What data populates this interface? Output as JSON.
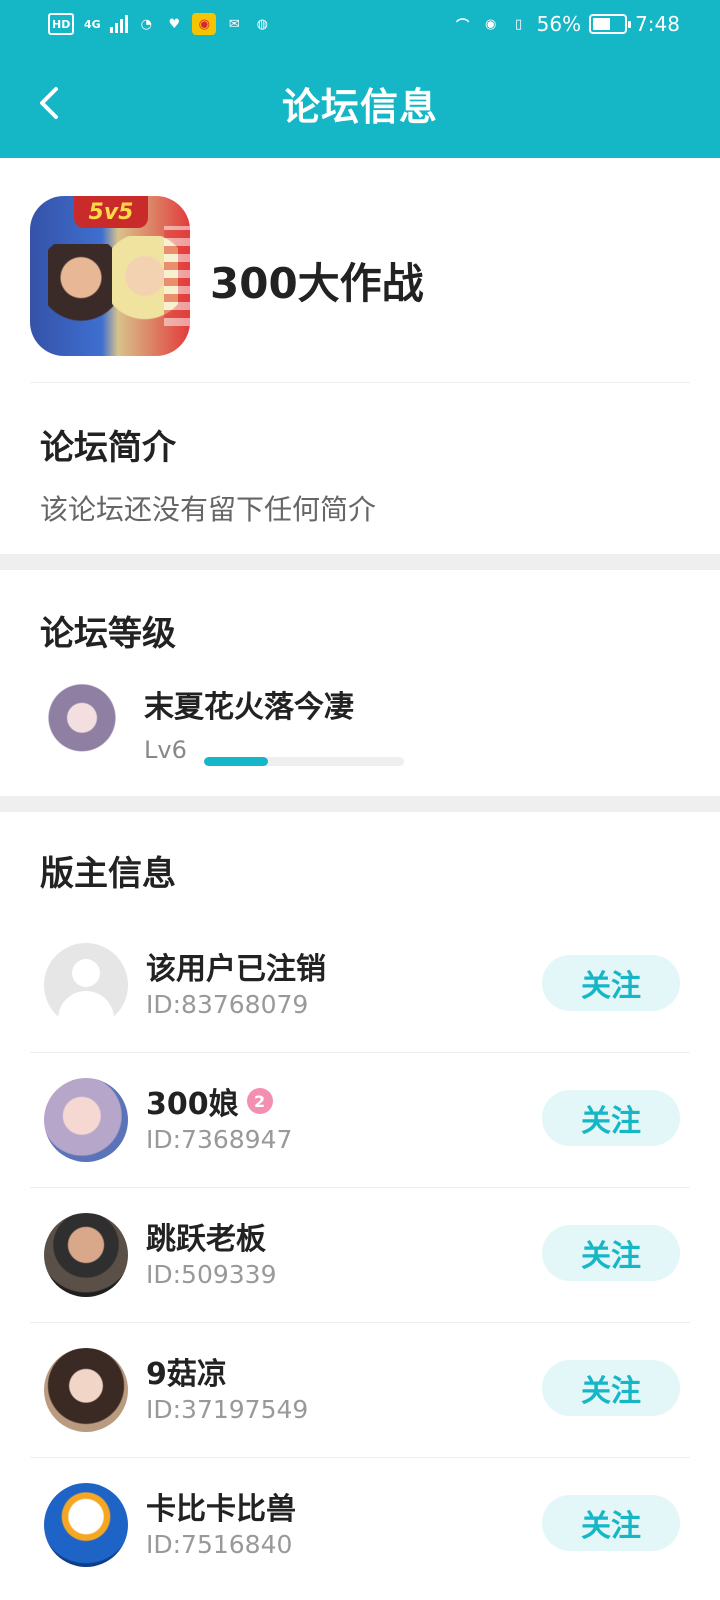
{
  "status_bar": {
    "hd": "HD",
    "network": "4G",
    "battery_percent": "56%",
    "time": "7:48",
    "battery_level": 0.56
  },
  "navbar": {
    "title": "论坛信息",
    "back_icon": "chevron-left-icon"
  },
  "forum": {
    "name": "300大作战",
    "logo_badge": "5v5"
  },
  "intro": {
    "title": "论坛简介",
    "text": "该论坛还没有留下任何简介"
  },
  "level": {
    "title": "论坛等级",
    "user_name": "末夏花火落今凄",
    "level_label": "Lv6",
    "progress": 0.32
  },
  "moderators": {
    "title": "版主信息",
    "items": [
      {
        "name": "该用户已注销",
        "id": "ID:83768079",
        "follow": "关注",
        "avatar": "default-avatar"
      },
      {
        "name": "300娘",
        "badge": "2",
        "id": "ID:7368947",
        "follow": "关注",
        "avatar": "anime-avatar"
      },
      {
        "name": "跳跃老板",
        "id": "ID:509339",
        "follow": "关注",
        "avatar": "man-avatar"
      },
      {
        "name": "9菇凉",
        "id": "ID:37197549",
        "follow": "关注",
        "avatar": "woman-avatar"
      },
      {
        "name": "卡比卡比兽",
        "id": "ID:7516840",
        "follow": "关注",
        "avatar": "duck-avatar"
      }
    ]
  },
  "colors": {
    "accent": "#15b7c7",
    "follow_bg": "#e3f6f8"
  }
}
